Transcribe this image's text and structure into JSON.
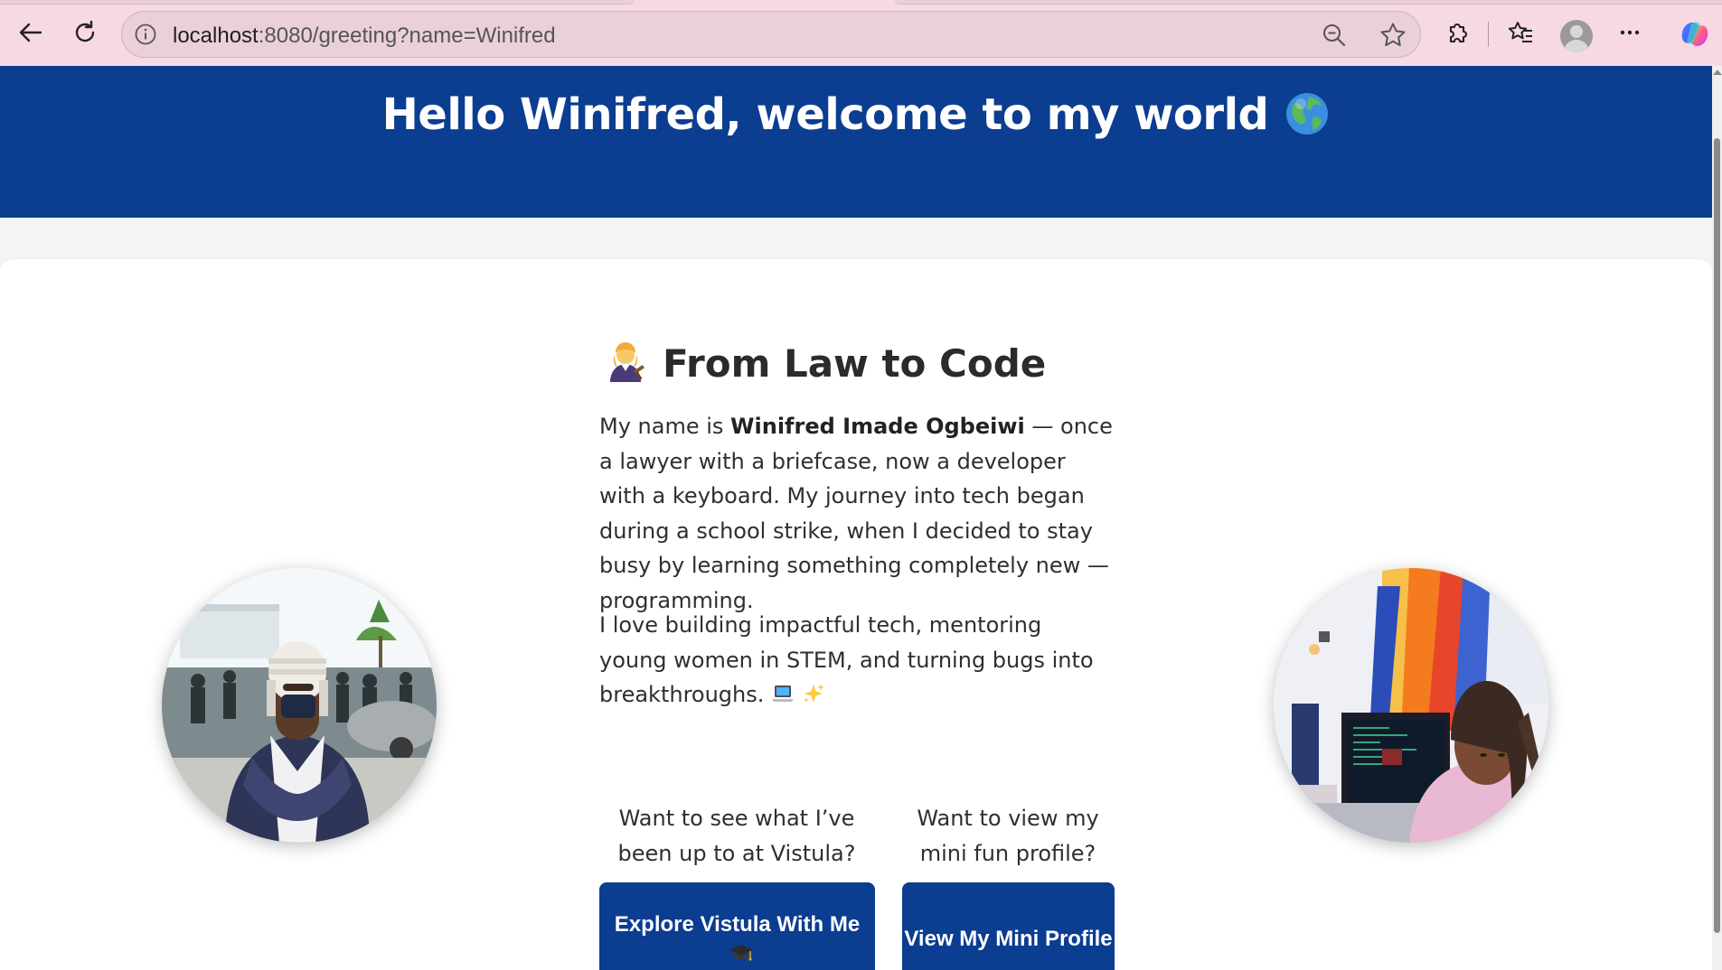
{
  "browser": {
    "url_host": "localhost",
    "url_rest": ":8080/greeting?name=Winifred"
  },
  "hero": {
    "title": "Hello Winifred, welcome to my world"
  },
  "about": {
    "title": "From Law to Code",
    "para1_prefix": "My name is ",
    "para1_name": "Winifred Imade Ogbeiwi",
    "para1_rest": " — once a lawyer with a briefcase, now a developer with a keyboard. My journey into tech began during a school strike, when I decided to stay busy by learning something completely new — programming.",
    "para2": "I love building impactful tech, mentoring young women in STEM, and turning bugs into breakthroughs."
  },
  "cta": {
    "vistula_prompt": "Want to see what I’ve been up to at Vistula?",
    "vistula_button": "Explore Vistula With Me",
    "profile_prompt": "Want to view my mini fun profile?",
    "profile_button": "View My Mini Profile"
  },
  "colors": {
    "brand_blue": "#0b3d91",
    "chrome_pink": "#f7d9e3"
  },
  "icons": [
    "back-arrow-icon",
    "reload-icon",
    "info-icon",
    "zoom-out-icon",
    "star-icon",
    "extensions-icon",
    "favorites-icon",
    "profile-avatar-icon",
    "more-icon",
    "copilot-icon",
    "globe-emoji-icon",
    "judge-emoji-icon",
    "laptop-emoji-icon",
    "sparkles-emoji-icon",
    "graduation-cap-emoji-icon"
  ]
}
